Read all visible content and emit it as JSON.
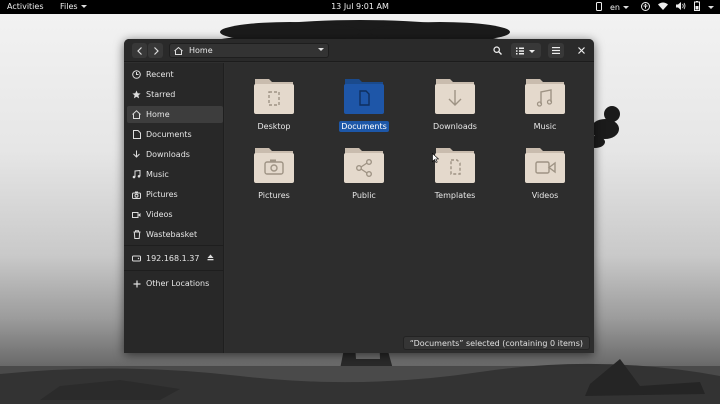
{
  "topbar": {
    "activities": "Activities",
    "app_name": "Files",
    "clock": "13 Jul  9:01 AM",
    "language": "en",
    "icons": [
      "phone-icon",
      "accessibility-icon",
      "wifi-icon",
      "volume-icon",
      "battery-icon",
      "power-menu-icon"
    ]
  },
  "header": {
    "path_label": "Home"
  },
  "sidebar": {
    "items": [
      {
        "label": "Recent",
        "icon": "clock-icon"
      },
      {
        "label": "Starred",
        "icon": "star-icon"
      },
      {
        "label": "Home",
        "icon": "home-icon"
      },
      {
        "label": "Documents",
        "icon": "document-icon"
      },
      {
        "label": "Downloads",
        "icon": "download-icon"
      },
      {
        "label": "Music",
        "icon": "music-icon"
      },
      {
        "label": "Pictures",
        "icon": "camera-icon"
      },
      {
        "label": "Videos",
        "icon": "video-icon"
      },
      {
        "label": "Wastebasket",
        "icon": "trash-icon"
      }
    ],
    "network_drive": {
      "label": "192.168.1.37",
      "icon": "drive-icon"
    },
    "other_locations": {
      "label": "Other Locations",
      "icon": "plus-icon"
    }
  },
  "files": [
    {
      "name": "Desktop",
      "emblem": "desktop-emblem"
    },
    {
      "name": "Documents",
      "emblem": "document-emblem",
      "selected": true
    },
    {
      "name": "Downloads",
      "emblem": "download-emblem"
    },
    {
      "name": "Music",
      "emblem": "music-emblem"
    },
    {
      "name": "Pictures",
      "emblem": "camera-emblem"
    },
    {
      "name": "Public",
      "emblem": "share-emblem"
    },
    {
      "name": "Templates",
      "emblem": "template-emblem"
    },
    {
      "name": "Videos",
      "emblem": "video-emblem"
    }
  ],
  "status": "“Documents” selected (containing 0 items)",
  "colors": {
    "selection": "#1d57a8",
    "folder": "#e4d9cc",
    "window_bg": "#2d2d2d",
    "sidebar_bg": "#282828"
  }
}
